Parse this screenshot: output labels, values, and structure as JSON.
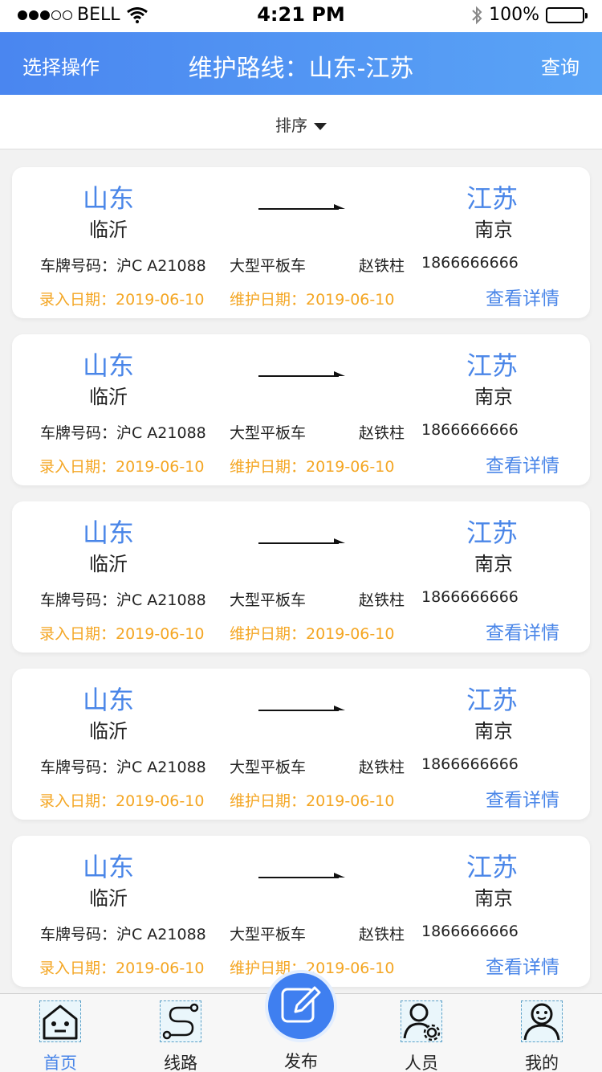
{
  "status_bar": {
    "carrier": "BELL",
    "time": "4:21 PM",
    "battery": "100%"
  },
  "nav": {
    "left": "选择操作",
    "title": "维护路线：山东-江苏",
    "right": "查询"
  },
  "sort": {
    "label": "排序"
  },
  "cards": [
    {
      "from_prov": "山东",
      "from_city": "临沂",
      "to_prov": "江苏",
      "to_city": "南京",
      "plate": "车牌号码：沪C A21088",
      "vehicle": "大型平板车",
      "driver": "赵铁柱",
      "phone": "1866666666",
      "entry_date": "录入日期：2019-06-10",
      "maint_date": "维护日期：2019-06-10",
      "detail": "查看详情"
    },
    {
      "from_prov": "山东",
      "from_city": "临沂",
      "to_prov": "江苏",
      "to_city": "南京",
      "plate": "车牌号码：沪C A21088",
      "vehicle": "大型平板车",
      "driver": "赵铁柱",
      "phone": "1866666666",
      "entry_date": "录入日期：2019-06-10",
      "maint_date": "维护日期：2019-06-10",
      "detail": "查看详情"
    },
    {
      "from_prov": "山东",
      "from_city": "临沂",
      "to_prov": "江苏",
      "to_city": "南京",
      "plate": "车牌号码：沪C A21088",
      "vehicle": "大型平板车",
      "driver": "赵铁柱",
      "phone": "1866666666",
      "entry_date": "录入日期：2019-06-10",
      "maint_date": "维护日期：2019-06-10",
      "detail": "查看详情"
    },
    {
      "from_prov": "山东",
      "from_city": "临沂",
      "to_prov": "江苏",
      "to_city": "南京",
      "plate": "车牌号码：沪C A21088",
      "vehicle": "大型平板车",
      "driver": "赵铁柱",
      "phone": "1866666666",
      "entry_date": "录入日期：2019-06-10",
      "maint_date": "维护日期：2019-06-10",
      "detail": "查看详情"
    },
    {
      "from_prov": "山东",
      "from_city": "临沂",
      "to_prov": "江苏",
      "to_city": "南京",
      "plate": "车牌号码：沪C A21088",
      "vehicle": "大型平板车",
      "driver": "赵铁柱",
      "phone": "1866666666",
      "entry_date": "录入日期：2019-06-10",
      "maint_date": "维护日期：2019-06-10",
      "detail": "查看详情"
    }
  ],
  "tabs": [
    {
      "label": "首页",
      "icon": "home-robot-icon",
      "active": true
    },
    {
      "label": "线路",
      "icon": "route-icon",
      "active": false
    },
    {
      "label": "发布",
      "icon": "edit-icon",
      "active": false
    },
    {
      "label": "人员",
      "icon": "user-settings-icon",
      "active": false
    },
    {
      "label": "我的",
      "icon": "profile-icon",
      "active": false
    }
  ],
  "colors": {
    "accent": "#4a86e8",
    "date": "#f4a623",
    "nav_start": "#4a86f0",
    "nav_end": "#5aa4f6"
  }
}
